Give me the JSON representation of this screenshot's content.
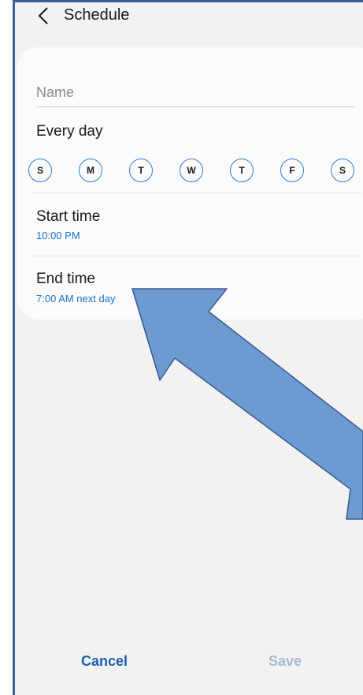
{
  "header": {
    "title": "Schedule"
  },
  "form": {
    "name_placeholder": "Name",
    "repeat_label": "Every day",
    "days": [
      "S",
      "M",
      "T",
      "W",
      "T",
      "F",
      "S"
    ],
    "start": {
      "title": "Start time",
      "value": "10:00 PM"
    },
    "end": {
      "title": "End time",
      "value": "7:00 AM next day"
    }
  },
  "footer": {
    "cancel_label": "Cancel",
    "save_label": "Save"
  },
  "colors": {
    "accent": "#1a73c8",
    "annotation_arrow_fill": "#6d9bd1",
    "annotation_arrow_stroke": "#3a5b8c"
  },
  "icons": {
    "back": "back-chevron-icon"
  }
}
